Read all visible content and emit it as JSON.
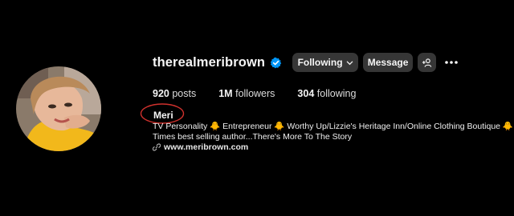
{
  "profile": {
    "username": "therealmeribrown",
    "verified": true,
    "following_button": "Following",
    "message_button": "Message"
  },
  "stats": {
    "posts_count": "920",
    "posts_label": "posts",
    "followers_count": "1M",
    "followers_label": "followers",
    "following_count": "304",
    "following_label": "following"
  },
  "bio": {
    "name": "Meri",
    "line1": "TV Personality 🐥 Entrepreneur 🐥 Worthy Up/Lizzie's Heritage Inn/Online Clothing Boutique 🐥 NY",
    "line2": "Times best selling author...There's More To The Story",
    "link": "www.meribrown.com"
  },
  "colors": {
    "background": "#000000",
    "button": "#363636",
    "verified": "#0095f6",
    "annotation": "#d0312d"
  },
  "icons": [
    "verified-badge-icon",
    "chevron-down-icon",
    "add-user-icon",
    "more-options-icon",
    "link-icon"
  ]
}
